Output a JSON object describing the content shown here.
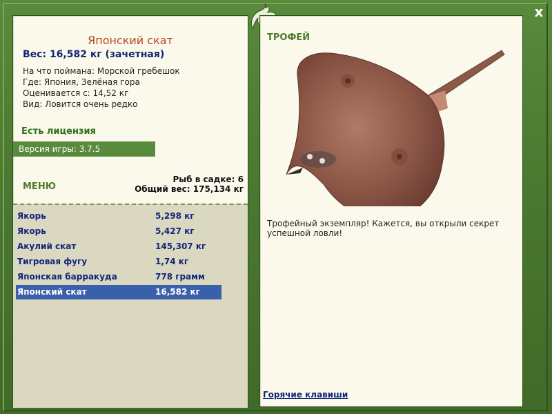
{
  "colors": {
    "frame": "#4f7a35",
    "panel": "#fbf9ec",
    "title_color": "#b3461c",
    "weight_color": "#0f2670",
    "license_color": "#2f6e20",
    "selection": "#3a5fab",
    "list_bg": "#dad8c0"
  },
  "icons": {
    "close": "close-icon",
    "logo": "lizard-logo-icon"
  },
  "close_glyph": "x",
  "fish": {
    "title": "Японский скат",
    "weight": "Вес: 16,582 кг (зачетная)",
    "bait": "На что поймана: Морской гребешок",
    "location": "Где: Япония, Зелёная гора",
    "valued_from": "Оценивается с: 14,52 кг",
    "rarity": "Вид: Ловится очень редко"
  },
  "license": "Есть лицензия",
  "version": "Версия игры: 3.7.5",
  "menu_label": "МЕНЮ",
  "cage": {
    "count": "Рыб в садке: 6",
    "total": "Общий вес: 175,134 кг"
  },
  "catch_list": [
    {
      "name": "Якорь",
      "weight": "5,298 кг",
      "selected": false
    },
    {
      "name": "Якорь",
      "weight": "5,427 кг",
      "selected": false
    },
    {
      "name": "Акулий скат",
      "weight": "145,307 кг",
      "selected": false
    },
    {
      "name": "Тигровая фугу",
      "weight": "1,74 кг",
      "selected": false
    },
    {
      "name": "Японская барракуда",
      "weight": "778 грамм",
      "selected": false
    },
    {
      "name": "Японский скат",
      "weight": "16,582 кг",
      "selected": true
    }
  ],
  "trophy": {
    "label": "ТРОФЕЙ",
    "message": "Трофейный экземпляр! Кажется, вы открыли секрет успешной ловли!"
  },
  "hotkeys": "Горячие клавиши"
}
